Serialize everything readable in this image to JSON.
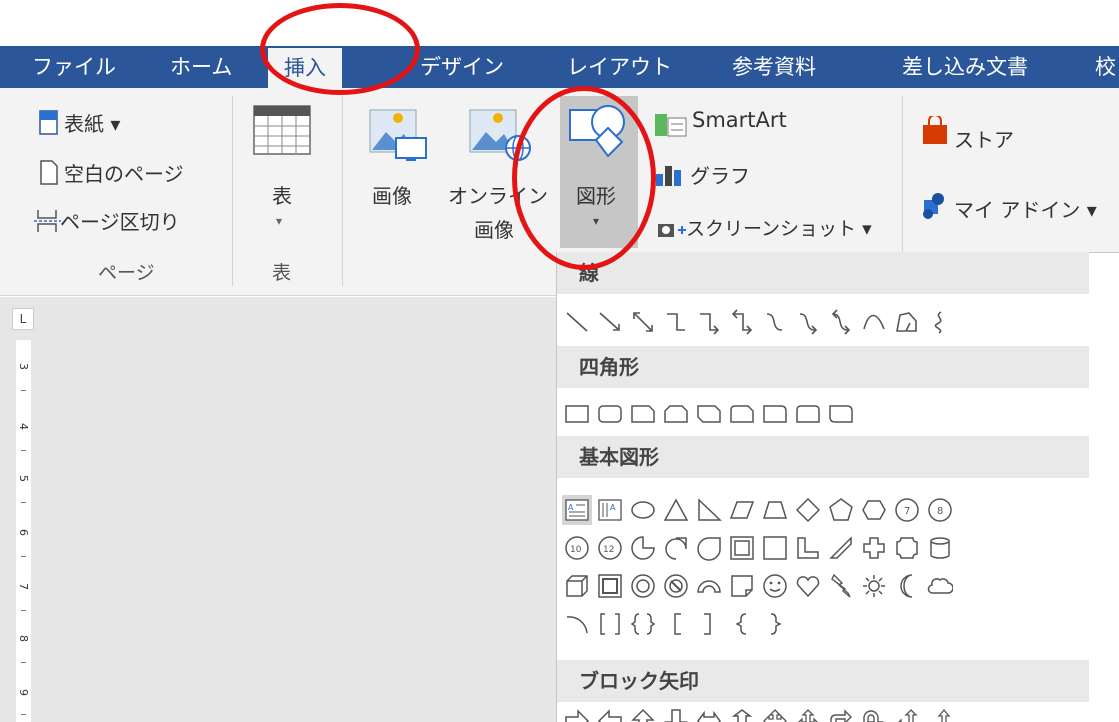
{
  "tabs": [
    {
      "label": "ファイル"
    },
    {
      "label": "ホーム"
    },
    {
      "label": "挿入"
    },
    {
      "label": "デザイン"
    },
    {
      "label": "レイアウト"
    },
    {
      "label": "参考資料"
    },
    {
      "label": "差し込み文書"
    },
    {
      "label": "校"
    }
  ],
  "page_group": {
    "cover": "表紙 ▾",
    "blank": "空白のページ",
    "break": "ページ区切り",
    "label": "ページ"
  },
  "table_group": {
    "button": "表",
    "caret": "▾",
    "label": "表"
  },
  "illustrations": {
    "image": "画像",
    "online_image_1": "オンライン",
    "online_image_2": "画像",
    "shapes": "図形",
    "shapes_caret": "▾",
    "smartart": "SmartArt",
    "chart": "グラフ",
    "screenshot": "スクリーンショット ▾"
  },
  "addins": {
    "store": "ストア",
    "my_addins": "マイ アドイン ▾"
  },
  "ruler": {
    "corner": "L",
    "numbers": [
      "3",
      "4",
      "5",
      "6",
      "7",
      "8",
      "9"
    ]
  },
  "shapes_menu": {
    "lines": "線",
    "rectangles": "四角形",
    "basic": "基本図形",
    "block_arrows": "ブロック矢印"
  },
  "colors": {
    "tab_bar": "#2b579a",
    "ribbon": "#f3f3f3",
    "annotation": "#e41414"
  }
}
